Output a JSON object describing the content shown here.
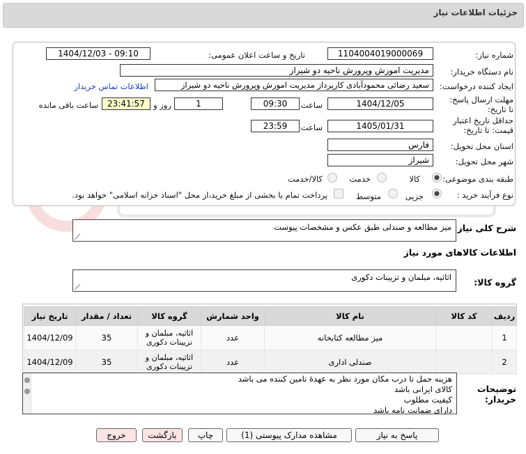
{
  "header": {
    "title": "جزئیات اطلاعات نیاز"
  },
  "form": {
    "need_number_label": "شماره نیاز:",
    "need_number": "1104004019000069",
    "announce_label": "تاریخ و ساعت اعلان عمومی:",
    "announce_value": "1404/12/03 - 09:10",
    "buyer_org_label": "نام دستگاه خریدار:",
    "buyer_org": "مدیریت اموزش وپرورش ناحیه دو شیراز",
    "requester_label": "ایجاد کننده درخواست:",
    "requester": "سعید رضائی محمودآبادی کارپرداز مدیریت اموزش وپرورش ناحیه دو شیراز",
    "contact_link": "اطلاعات تماس خریدار",
    "deadline_label": "مهلت ارسال پاسخ: تا تاریخ:",
    "deadline_date": "1404/12/05",
    "time_label": "ساعت",
    "deadline_time": "09:30",
    "days_value": "1",
    "days_label": "روز و",
    "remaining_time": "23:41:57",
    "remaining_label": "ساعت باقی مانده",
    "validity_label": "حداقل تاریخ اعتبار قیمت: تا تاریخ:",
    "validity_date": "1405/01/31",
    "validity_time": "23:59",
    "province_label": "استان محل تحویل:",
    "province": "فارس",
    "city_label": "شهر محل تحویل:",
    "city": "شیراز",
    "category_label": "طبقه بندی موضوعی:",
    "category_options": [
      "کالا",
      "خدمت",
      "کالا/خدمت"
    ],
    "process_label": "نوع فرآیند خرید :",
    "process_options": [
      "جزیی",
      "متوسط"
    ],
    "payment_note": "پرداخت تمام یا بخشی از مبلغ خرید،از محل \"اسناد خزانه اسلامی\" خواهد بود."
  },
  "summary": {
    "label": "شرح کلی نیاز:",
    "value": "میز مطالعه و صندلی طبق عکس و مشخصات پیوست"
  },
  "goods_info_title": "اطلاعات کالاهای مورد نیاز",
  "goods_group": {
    "label": "گروه کالا:",
    "value": "اثاثیه، مبلمان و تزیینات دکوری"
  },
  "table": {
    "headers": [
      "ردیف",
      "کد کالا",
      "نام کالا",
      "واحد شمارش",
      "گروه کالا",
      "تعداد / مقدار",
      "تاریخ نیاز"
    ],
    "rows": [
      {
        "row": "1",
        "code": "",
        "name": "میز مطالعه کتابخانه",
        "unit": "عدد",
        "group": "اثاثیه، مبلمان و تزیینات دکوری",
        "qty": "35",
        "date": "1404/12/09"
      },
      {
        "row": "2",
        "code": "",
        "name": "صندلی اداری",
        "unit": "عدد",
        "group": "اثاثیه، مبلمان و تزیینات دکوری",
        "qty": "35",
        "date": "1404/12/09"
      }
    ]
  },
  "notes": {
    "label": "توضیحات خریدار:",
    "lines": [
      "هزینه حمل تا درب مکان مورد نظر به عهدهٔ تامین کننده می باشد",
      "کالای ایرانی باشد",
      "کیفیت مطلوب",
      "دارای ضمانت نامه باشد"
    ]
  },
  "buttons": {
    "reply": "پاسخ به نیاز",
    "attachments": "مشاهده مدارک پیوستی (1)",
    "print": "چاپ",
    "back": "بازگشت",
    "exit": "خروج"
  },
  "colors": {
    "header_bg": "#d9d9d9",
    "link": "#1a3fb8",
    "highlight": "#ffffcc",
    "pink_button": "#fde4e4"
  }
}
